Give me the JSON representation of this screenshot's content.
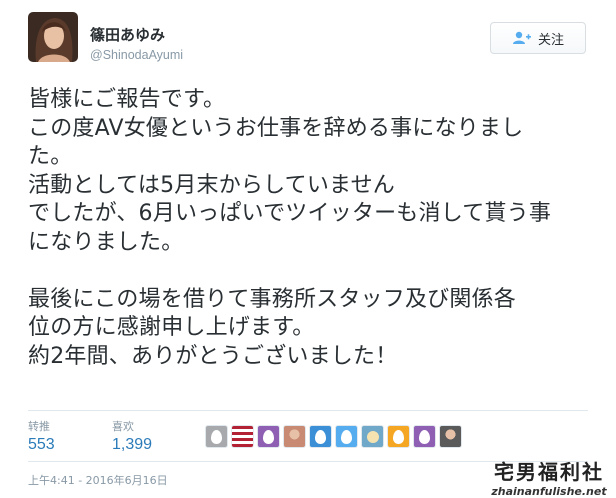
{
  "user": {
    "display_name": "篠田あゆみ",
    "handle": "@ShinodaAyumi"
  },
  "follow_button": {
    "label": "关注",
    "icon": "add-user-icon"
  },
  "tweet": {
    "lines": [
      "皆様にご報告です。",
      "この度AV女優というお仕事を辞める事になりまし",
      "た。",
      "活動としては5月末からしていません",
      "でしたが、6月いっぱいでツイッターも消して貰う事",
      "になりました。",
      "",
      "最後にこの場を借りて事務所スタッフ及び関係各",
      "位の方に感謝申し上げます。",
      "約2年間、ありがとうございました！"
    ]
  },
  "stats": {
    "retweets_label": "转推",
    "retweets_value": "553",
    "likes_label": "喜欢",
    "likes_value": "1,399"
  },
  "likers": {
    "avatars": [
      {
        "icon": "egg-avatar-icon",
        "color": "#a7a9ac"
      },
      {
        "icon": "flag-avatar-icon",
        "color": "#b22234"
      },
      {
        "icon": "egg-avatar-icon",
        "color": "#8e5fb3"
      },
      {
        "icon": "photo-avatar-icon",
        "color": "#c98a73"
      },
      {
        "icon": "egg-avatar-icon",
        "color": "#3a8fd6"
      },
      {
        "icon": "egg-avatar-icon",
        "color": "#55acee"
      },
      {
        "icon": "character-avatar-icon",
        "color": "#6fa8c8"
      },
      {
        "icon": "egg-avatar-icon",
        "color": "#f5a623"
      },
      {
        "icon": "egg-avatar-icon",
        "color": "#8e5fb3"
      },
      {
        "icon": "photo-avatar-icon",
        "color": "#5a5a5a"
      }
    ]
  },
  "timestamp": "上午4:41 - 2016年6月16日",
  "watermark": {
    "title": "宅男福利社",
    "url": "zhainanfulishe.net"
  },
  "colors": {
    "link": "#2b7bb9",
    "muted": "#8899a6",
    "text": "#292f33",
    "border": "#e1e8ed"
  }
}
